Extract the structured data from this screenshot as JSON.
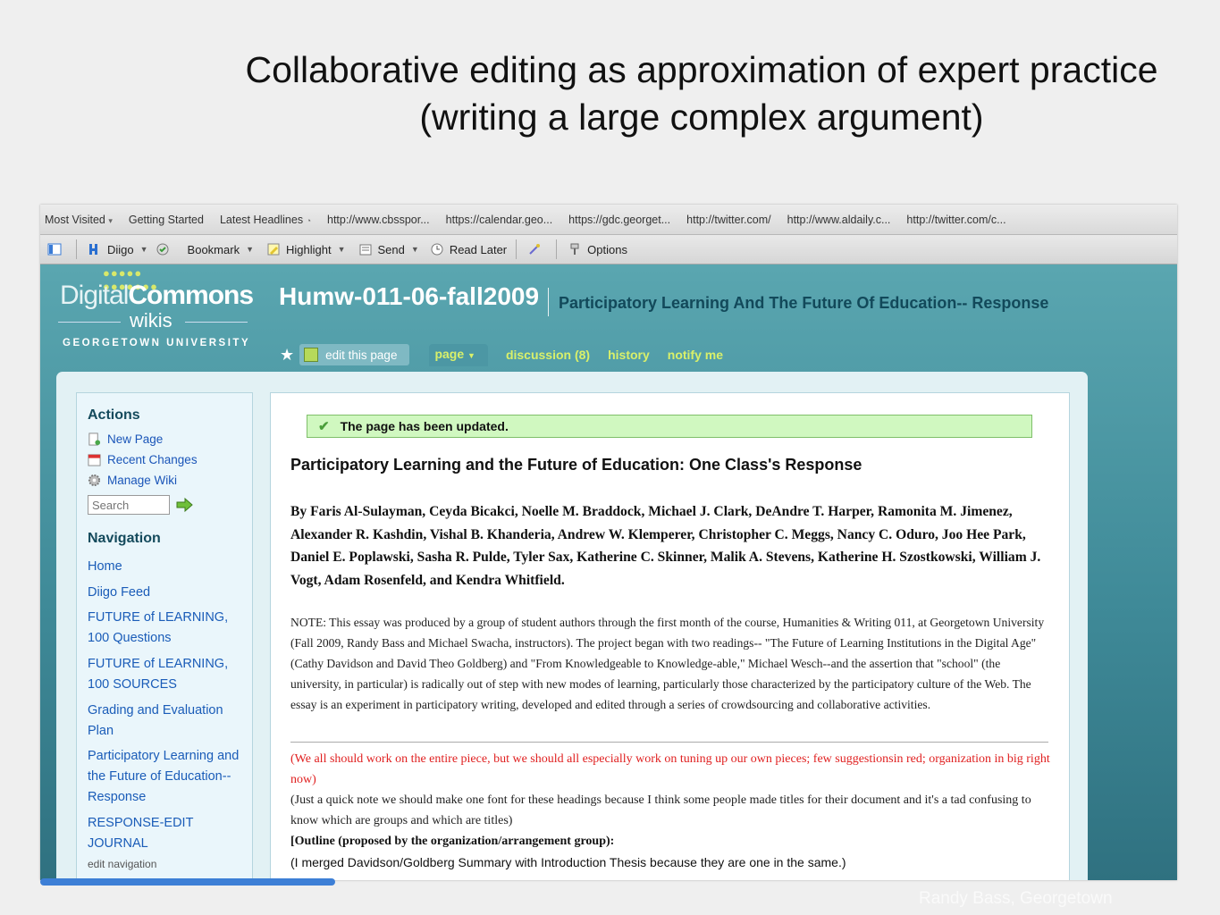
{
  "slide": {
    "title_line1": "Collaborative editing as approximation of expert practice",
    "title_line2": "(writing a large complex argument)",
    "credit": "Randy Bass, Georgetown"
  },
  "browser": {
    "bookmarks": [
      "Most Visited",
      "Getting Started",
      "Latest Headlines",
      "http://www.cbsspor...",
      "https://calendar.geo...",
      "https://gdc.georget...",
      "http://twitter.com/",
      "http://www.aldaily.c...",
      "http://twitter.com/c..."
    ],
    "toolbar": {
      "diigo": "Diigo",
      "bookmark": "Bookmark",
      "highlight": "Highlight",
      "send": "Send",
      "read_later": "Read Later",
      "options": "Options"
    }
  },
  "wiki": {
    "logo": {
      "digital": "Digital",
      "commons": "Commons",
      "wikis": "wikis",
      "university": "GEORGETOWN UNIVERSITY"
    },
    "name": "Humw-011-06-fall2009",
    "page_title": "Participatory Learning And The Future Of Education-- Response",
    "tabs": {
      "edit": "edit this page",
      "page": "page",
      "discussion": "discussion (8)",
      "history": "history",
      "notify": "notify me"
    },
    "sidebar": {
      "actions_title": "Actions",
      "new_page": "New Page",
      "recent_changes": "Recent Changes",
      "manage_wiki": "Manage Wiki",
      "search_placeholder": "Search",
      "navigation_title": "Navigation",
      "nav": [
        "Home",
        "Diigo Feed",
        "FUTURE of LEARNING, 100 Questions",
        "FUTURE of LEARNING, 100 SOURCES",
        "Grading and Evaluation Plan",
        "Participatory Learning and the Future of Education--Response",
        "RESPONSE-EDIT JOURNAL"
      ],
      "edit_navigation": "edit navigation"
    },
    "main": {
      "notice": "The page has been updated.",
      "doc_title": "Participatory Learning and the Future of Education: One Class's Response",
      "authors": "By Faris Al-Sulayman, Ceyda Bicakci, Noelle M. Braddock, Michael J. Clark, DeAndre T. Harper, Ramonita M. Jimenez, Alexander R. Kashdin, Vishal B. Khanderia, Andrew W. Klemperer, Christopher C. Meggs, Nancy C. Oduro, Joo Hee Park, Daniel E. Poplawski, Sasha R. Pulde, Tyler Sax, Katherine C. Skinner, Malik A. Stevens, Katherine H. Szostkowski, William J. Vogt, Adam Rosenfeld, and Kendra Whitfield.",
      "note": "NOTE: This essay was produced by a group of student authors through the first month of the course, Humanities & Writing 011, at Georgetown University (Fall 2009, Randy Bass and Michael Swacha, instructors). The project began with two readings-- \"The Future of Learning Institutions in the Digital Age\" (Cathy Davidson and David Theo Goldberg) and \"From Knowledgeable to Knowledge-able,\" Michael Wesch--and the assertion that \"school\" (the university, in particular) is radically out of step with new modes of learning, particularly those characterized by the participatory culture of the Web. The essay is an experiment in participatory writing, developed and edited through a series of crowdsourcing and collaborative activities.",
      "red_note": "(We all should work on the entire piece, but we should all especially work on tuning up our own pieces; few suggestionsin red; organization in big right now)",
      "quick_note": "(Just a quick note we should make one font for these headings because I think some people made titles for their document and it's a tad confusing to know which are groups and which are titles)",
      "outline": "[Outline (proposed by the organization/arrangement group):",
      "merged": "(I merged Davidson/Goldberg Summary with Introduction Thesis because they are one in the same.)"
    }
  }
}
